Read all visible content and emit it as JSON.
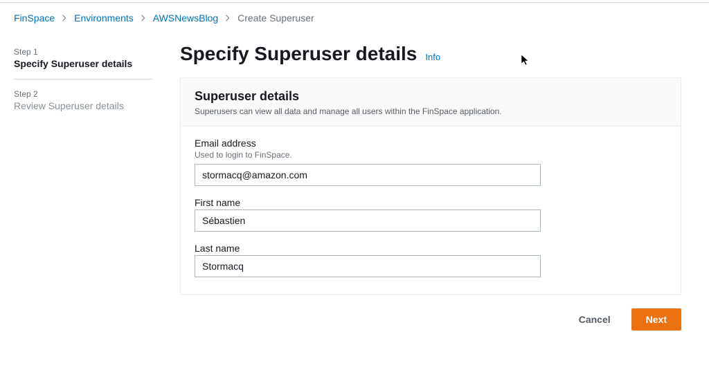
{
  "breadcrumbs": {
    "items": [
      {
        "label": "FinSpace",
        "link": true
      },
      {
        "label": "Environments",
        "link": true
      },
      {
        "label": "AWSNewsBlog",
        "link": true
      },
      {
        "label": "Create Superuser",
        "link": false
      }
    ]
  },
  "sidebar": {
    "steps": [
      {
        "label": "Step 1",
        "title": "Specify Superuser details",
        "active": true
      },
      {
        "label": "Step 2",
        "title": "Review Superuser details",
        "active": false
      }
    ]
  },
  "page": {
    "heading": "Specify Superuser details",
    "info_label": "Info"
  },
  "panel": {
    "title": "Superuser details",
    "subtitle": "Superusers can view all data and manage all users within the FinSpace application."
  },
  "form": {
    "email": {
      "label": "Email address",
      "hint": "Used to login to FinSpace.",
      "value": "stormacq@amazon.com"
    },
    "first_name": {
      "label": "First name",
      "value": "Sébastien"
    },
    "last_name": {
      "label": "Last name",
      "value": "Stormacq"
    }
  },
  "buttons": {
    "cancel": "Cancel",
    "next": "Next"
  }
}
